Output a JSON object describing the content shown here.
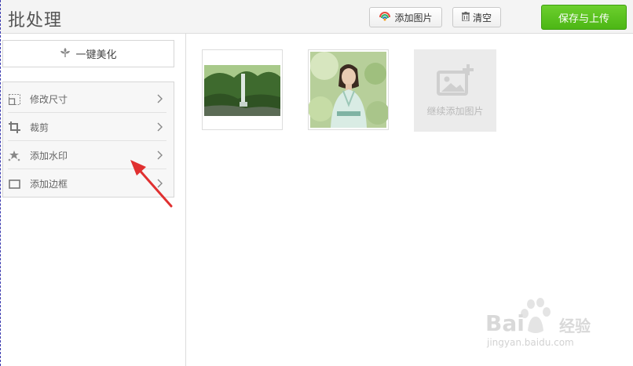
{
  "header": {
    "title": "批处理",
    "add_image_label": "添加图片",
    "clear_label": "清空",
    "save_upload_label": "保存与上传"
  },
  "sidebar": {
    "beautify_label": "一键美化",
    "tools": [
      {
        "label": "修改尺寸",
        "icon": "resize-icon"
      },
      {
        "label": "裁剪",
        "icon": "crop-icon"
      },
      {
        "label": "添加水印",
        "icon": "watermark-icon"
      },
      {
        "label": "添加边框",
        "icon": "frame-icon"
      }
    ]
  },
  "main": {
    "images": [
      {
        "name": "waterfall-thumbnail"
      },
      {
        "name": "woman-portrait-thumbnail"
      }
    ],
    "add_more_label": "继续添加图片"
  },
  "watermark": {
    "brand": "Bai",
    "brand_suffix": "经验",
    "url": "jingyan.baidu.com"
  },
  "colors": {
    "accent_green": "#52b91c",
    "arrow_red": "#e03030"
  }
}
